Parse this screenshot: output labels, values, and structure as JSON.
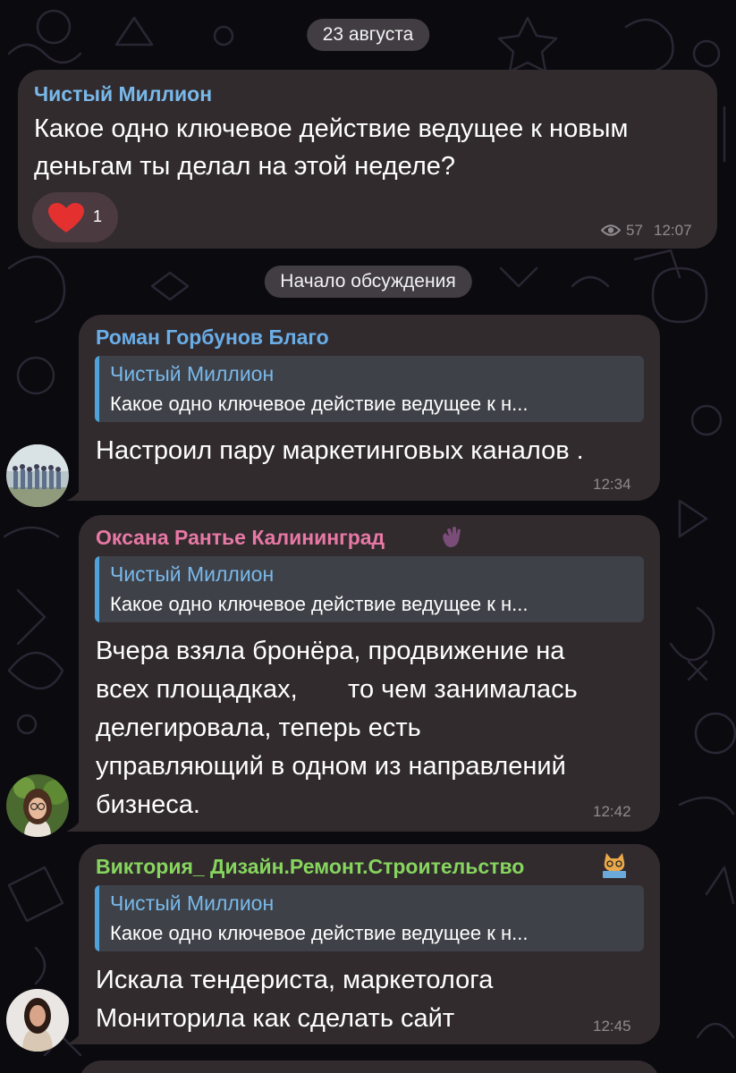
{
  "colors": {
    "background": "#0b0a0f",
    "bubble": "#312b2e",
    "reply_bg": "#3e4148",
    "reply_bar": "#4fa3d9",
    "channel_name": "#79b9ea",
    "name_roman": "#6aaee8",
    "name_oksana": "#e878a4",
    "name_viktoriya": "#86d55e",
    "reaction_heart": "#e4312f"
  },
  "date_divider": "23 августа",
  "channel_post": {
    "sender": "Чистый Миллион",
    "text_lines": [
      "Какое одно ключевое действие ведущее к новым",
      "деньгам ты делал на этой неделе?"
    ],
    "reaction": {
      "icon": "heart-icon",
      "count": "1"
    },
    "views": "57",
    "time": "12:07"
  },
  "discussion_divider": "Начало обсуждения",
  "replies": [
    {
      "sender": "Роман Горбунов Благо",
      "quote_name": "Чистый Миллион",
      "quote_text": "Какое одно ключевое действие ведущее к н...",
      "text_lines": [
        "Настроил пару маркетинговых каналов ."
      ],
      "time": "12:34"
    },
    {
      "sender": "Оксана Рантье Калининград",
      "emoji": "waving-hand-icon",
      "quote_name": "Чистый Миллион",
      "quote_text": "Какое одно ключевое действие ведущее к н...",
      "text_lines": [
        "Вчера взяла бронёра, продвижение на",
        "всех площадках,       то чем занималась",
        "делегировала, теперь есть",
        "управляющий в одном из направлений",
        "бизнеса."
      ],
      "time": "12:42"
    },
    {
      "sender": "Виктория_ Дизайн.Ремонт.Строительство",
      "emoji": "cat-at-laptop-icon",
      "quote_name": "Чистый Миллион",
      "quote_text": "Какое одно ключевое действие ведущее к н...",
      "text_lines": [
        "Искала тендериста, маркетолога",
        "Мониторила как сделать сайт"
      ],
      "time": "12:45"
    }
  ]
}
